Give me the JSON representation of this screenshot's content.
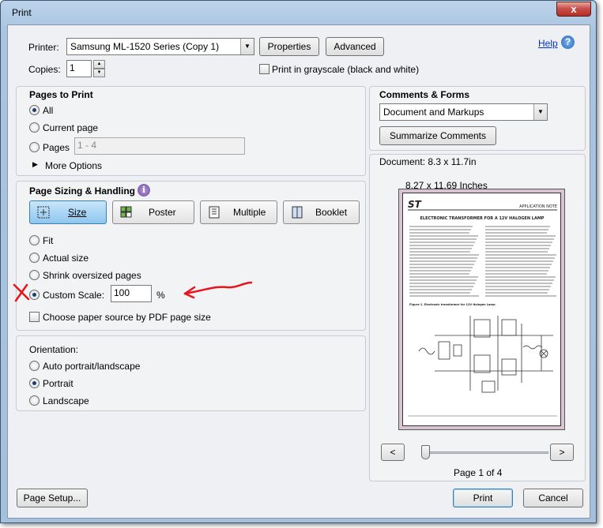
{
  "window": {
    "title": "Print",
    "close_glyph": "x"
  },
  "printer": {
    "label": "Printer:",
    "selected": "Samsung ML-1520 Series (Copy 1)",
    "properties_label": "Properties",
    "advanced_label": "Advanced",
    "help_label": "Help",
    "copies_label": "Copies:",
    "copies_value": "1",
    "grayscale_label": "Print in grayscale (black and white)",
    "grayscale_checked": false
  },
  "pages_to_print": {
    "title": "Pages to Print",
    "all_label": "All",
    "current_label": "Current page",
    "pages_label": "Pages",
    "pages_value": "1 - 4",
    "more_label": "More Options",
    "selected": "All"
  },
  "sizing": {
    "title": "Page Sizing & Handling",
    "buttons": [
      "Size",
      "Poster",
      "Multiple",
      "Booklet"
    ],
    "active_button": "Size",
    "fit_label": "Fit",
    "actual_label": "Actual size",
    "shrink_label": "Shrink oversized pages",
    "custom_label": "Custom Scale:",
    "custom_value": "100",
    "percent": "%",
    "paper_source_label": "Choose paper source by PDF page size",
    "selected": "Custom Scale",
    "annotation_color": "#e8141b"
  },
  "orientation": {
    "title": "Orientation:",
    "auto_label": "Auto portrait/landscape",
    "portrait_label": "Portrait",
    "landscape_label": "Landscape",
    "selected": "Portrait"
  },
  "comments": {
    "title": "Comments & Forms",
    "selected": "Document and Markups",
    "summarize_label": "Summarize Comments"
  },
  "preview": {
    "document_label": "Document: 8.3 x 11.7in",
    "size_label": "8.27 x 11.69 Inches",
    "prev_glyph": "<",
    "next_glyph": ">",
    "page_label": "Page 1 of 4",
    "doc": {
      "logo": "ST",
      "header": "APPLICATION NOTE",
      "title": "ELECTRONIC TRANSFORMER FOR A 12V HALOGEN LAMP",
      "figure_caption": "Figure 1. Electronic transformer for 12V Halogen Lamp"
    }
  },
  "footer": {
    "page_setup_label": "Page Setup...",
    "print_label": "Print",
    "cancel_label": "Cancel"
  }
}
